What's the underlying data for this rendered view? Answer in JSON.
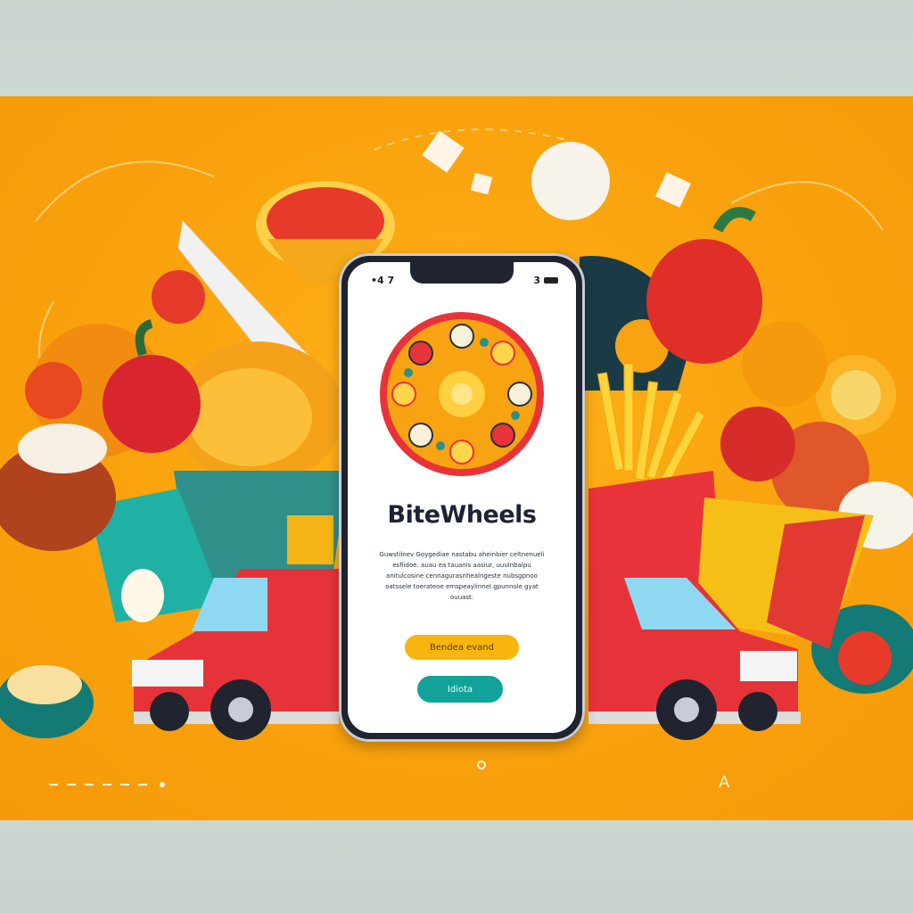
{
  "app": {
    "brand_name": "BiteWheels",
    "description": "Guwstilnev Goygediae nastabu aheinbier celtnenueli esfiidoe. auau ea tauanis aasiur, uuulnbalpu anitulcosine cennagurasnhealngeste nubsgpnoo oatssele toerateoe emspeaylinnel.gpunnole gyat ouuast."
  },
  "status_bar": {
    "time": "•4 7",
    "signal": "3"
  },
  "buttons": {
    "primary_label": "Bendea evand",
    "secondary_label": "Idiota"
  },
  "colors": {
    "background": "#f9a20d",
    "brand_text": "#1d2333",
    "primary_button": "#f7b50e",
    "secondary_button": "#11a39a",
    "truck": "#e6333a"
  }
}
